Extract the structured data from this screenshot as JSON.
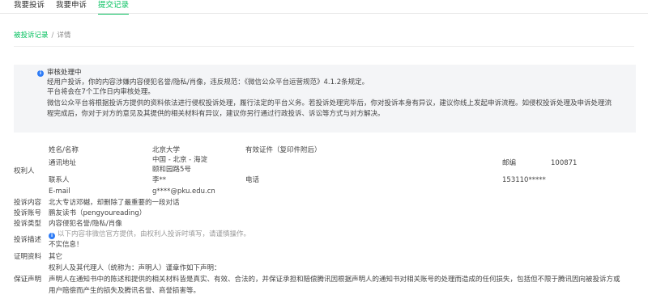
{
  "tabs": [
    {
      "label": "我要投诉",
      "active": false
    },
    {
      "label": "我要申诉",
      "active": false
    },
    {
      "label": "提交记录",
      "active": true
    }
  ],
  "breadcrumb": {
    "link": "被投诉记录",
    "sep": "/",
    "current": "详情"
  },
  "notice": {
    "title": "审核处理中",
    "line1": "经用户投诉，你的内容涉嫌内容侵犯名誉/隐私/肖像，违反规范：《微信公众平台运营规范》4.1.2条规定。",
    "line2": "平台将会在7个工作日内审核处理。",
    "line3": "微信公众平台将根据投诉方提供的资料依法进行侵权投诉处理，履行法定的平台义务。若投诉处理完毕后，你对投诉本身有异议，建议你线上发起申诉流程。如侵权投诉处理及申诉处理流",
    "line4": "程完成后，你对于对方的意见及其提供的相关材料有异议，建议你另行通过行政投诉、诉讼等方式与对方解决。"
  },
  "rights_holder": {
    "section_label": "权利人",
    "name_label": "姓名/名称",
    "name_value": "北京大学",
    "cert_label": "有效证件（复印件附后）",
    "address_label": "通讯地址",
    "address_line1": "中国 - 北京 - 海淀",
    "address_line2": "颐和园路5号",
    "zip_label": "邮编",
    "zip_value": "100871",
    "contact_label": "联系人",
    "contact_value": "李**",
    "phone_label": "电话",
    "phone_value": "153110*****",
    "email_label": "E-mail",
    "email_value": "g****@pku.edu.cn"
  },
  "details": {
    "content_label": "投诉内容",
    "content_value": "北大专访邓樾，却删除了最重要的一段对话",
    "account_label": "投诉账号",
    "account_value": "鹏友读书（pengyoureading）",
    "type_label": "投诉类型",
    "type_value": "内容侵犯名誉/隐私/肖像",
    "desc_label": "投诉描述",
    "desc_hint": "以下内容非微信官方提供，由权利人投诉时填写，请谨慎操作。",
    "desc_value": "不实信息！",
    "proof_label": "证明资料",
    "proof_value": "其它",
    "guarantee_label": "保证声明",
    "guarantee_line1": "权利人及其代理人（统称为：声明人）谨章作如下声明：",
    "guarantee_line2": "声明人在通知书中的陈述和提供的相关材料皆是真实、有效、合法的，并保证承担和赔偿腾讯因根据声明人的通知书对相关账号的处理而造成的任何损失，包括但不限于腾讯因向被投诉方或",
    "guarantee_line3": "用户赔偿而产生的损失及腾讯名誉、商誉损害等。"
  },
  "colors": {
    "accent": "#07c160",
    "info": "#2e7cf6",
    "notice_bg": "#f4f5f7"
  },
  "icons": {
    "notice": "info-icon",
    "hint": "info-icon"
  }
}
